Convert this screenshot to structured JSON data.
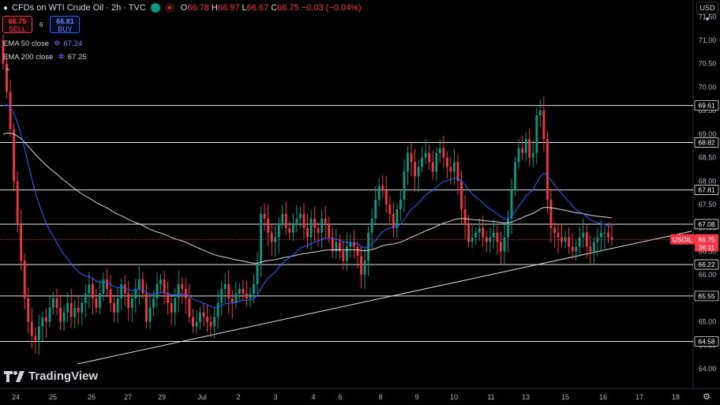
{
  "header": {
    "symbol_title": "CFDs on WTI Crude Oil · 2h · TVC",
    "ohlc_label_o": "O",
    "ohlc_o": "66.78",
    "ohlc_label_h": "H",
    "ohlc_h": "66.97",
    "ohlc_label_l": "L",
    "ohlc_l": "66.67",
    "ohlc_label_c": "C",
    "ohlc_c": "66.75",
    "change": "−0.03 (−0.04%)"
  },
  "trade": {
    "sell_price": "66.75",
    "sell_label": "SELL",
    "spread": "6",
    "buy_price": "66.81",
    "buy_label": "BUY"
  },
  "indicators": [
    {
      "label": "EMA 50 close",
      "value": "67.24",
      "color": "#2962ff"
    },
    {
      "label": "EMA 200 close",
      "value": "67.25",
      "color": "#e0e0e0"
    }
  ],
  "currency": "USD",
  "branding": "TradingView",
  "chart_data": {
    "type": "candlestick",
    "y_ticks": [
      71.5,
      71.0,
      70.5,
      70.0,
      69.5,
      69.0,
      68.5,
      68.0,
      67.5,
      67.0,
      66.5,
      66.0,
      65.5,
      65.0,
      64.5,
      64.0
    ],
    "y_tick_labels": [
      "71.50",
      "71.00",
      "70.50",
      "70.00",
      "69.50",
      "69.00",
      "68.50",
      "68.00",
      "67.50",
      "67.00",
      "66.50",
      "66.00",
      "65.50",
      "65.00",
      "64.50",
      "64.00"
    ],
    "ylim": [
      63.6,
      71.9
    ],
    "x_tick_labels": [
      "24",
      "25",
      "26",
      "27",
      "29",
      "Jul",
      "2",
      "3",
      "4",
      "6",
      "8",
      "9",
      "10",
      "11",
      "13",
      "15",
      "16",
      "17",
      "18"
    ],
    "horizontal_levels": [
      {
        "value": 69.61,
        "label": "69.61"
      },
      {
        "value": 68.82,
        "label": "68.82"
      },
      {
        "value": 67.81,
        "label": "67.81"
      },
      {
        "value": 67.08,
        "label": "67.08"
      },
      {
        "value": 66.22,
        "label": "66.22"
      },
      {
        "value": 65.55,
        "label": "65.55"
      },
      {
        "value": 64.58,
        "label": "64.58"
      }
    ],
    "current_price": {
      "symbol": "USOIL",
      "value": "66.75",
      "countdown": "36:11",
      "color": "#f23645"
    },
    "trendline": {
      "from_y": 64.1,
      "to_y": 66.93
    },
    "closes": [
      70.5,
      69.9,
      69.1,
      68.0,
      67.1,
      66.3,
      65.5,
      65.0,
      64.7,
      64.6,
      64.9,
      65.1,
      65.0,
      65.3,
      65.5,
      65.3,
      65.0,
      65.2,
      65.4,
      65.1,
      65.3,
      65.2,
      65.4,
      65.6,
      65.8,
      65.5,
      65.3,
      65.6,
      65.9,
      65.7,
      65.4,
      65.2,
      65.5,
      65.8,
      65.6,
      65.3,
      65.5,
      65.7,
      65.9,
      65.6,
      65.0,
      65.3,
      65.5,
      65.8,
      65.9,
      65.6,
      65.4,
      65.2,
      65.5,
      65.8,
      65.7,
      65.5,
      65.1,
      64.9,
      65.0,
      65.2,
      65.1,
      65.0,
      64.9,
      65.1,
      65.4,
      65.7,
      65.8,
      65.5,
      65.4,
      65.6,
      65.7,
      65.6,
      65.5,
      65.6,
      65.8,
      66.2,
      67.3,
      67.2,
      66.9,
      66.7,
      66.8,
      67.1,
      67.3,
      67.0,
      66.9,
      67.1,
      67.2,
      67.3,
      67.0,
      66.8,
      67.2,
      67.0,
      66.9,
      67.2,
      67.1,
      66.8,
      66.5,
      66.7,
      66.5,
      66.3,
      66.6,
      66.7,
      66.6,
      66.4,
      66.0,
      66.3,
      66.9,
      67.2,
      67.6,
      67.9,
      67.8,
      67.5,
      67.3,
      67.0,
      67.4,
      67.6,
      68.2,
      68.6,
      68.4,
      68.1,
      68.3,
      68.5,
      68.6,
      68.4,
      68.2,
      68.6,
      68.7,
      68.5,
      68.3,
      68.2,
      68.4,
      68.0,
      67.4,
      67.1,
      66.7,
      66.8,
      66.9,
      67.0,
      66.8,
      66.7,
      66.8,
      66.9,
      66.7,
      66.5,
      66.8,
      67.2,
      67.8,
      68.4,
      68.7,
      68.6,
      68.9,
      68.5,
      68.6,
      69.4,
      69.5,
      68.9,
      67.6,
      67.0,
      66.9,
      66.8,
      66.7,
      66.8,
      66.6,
      66.5,
      66.6,
      66.8,
      66.9,
      66.6,
      66.5,
      66.7,
      66.8,
      66.9,
      66.9,
      66.8,
      66.75
    ],
    "ema50": {
      "color": "#2962ff"
    },
    "ema200": {
      "color": "#d8d8d8"
    }
  }
}
